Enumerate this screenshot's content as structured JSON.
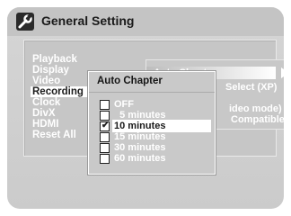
{
  "titlebar": {
    "title": "General Setting",
    "icon": "wrench-icon"
  },
  "menu": {
    "items": [
      {
        "label": "Playback"
      },
      {
        "label": "Display"
      },
      {
        "label": "Video"
      },
      {
        "label": "Recording"
      },
      {
        "label": "Clock"
      },
      {
        "label": "DivX"
      },
      {
        "label": "HDMI"
      },
      {
        "label": "Reset All"
      }
    ],
    "selected": "Recording"
  },
  "submenu": {
    "auto_chapter": "Auto Chapter",
    "line2": "Select (XP)",
    "line3": "ideo mode)",
    "line4": "Compatible"
  },
  "popup": {
    "title": "Auto Chapter",
    "options": [
      {
        "label": "OFF"
      },
      {
        "label": "  5 minutes"
      },
      {
        "label": "10 minutes"
      },
      {
        "label": "15 minutes"
      },
      {
        "label": "30 minutes"
      },
      {
        "label": "60 minutes"
      }
    ],
    "selected": "10 minutes"
  },
  "colors": {
    "screen_bg": "#cbcbcb",
    "highlight": "#ffffff",
    "text_light": "#ffffff",
    "text_dark": "#1a1a1a"
  }
}
